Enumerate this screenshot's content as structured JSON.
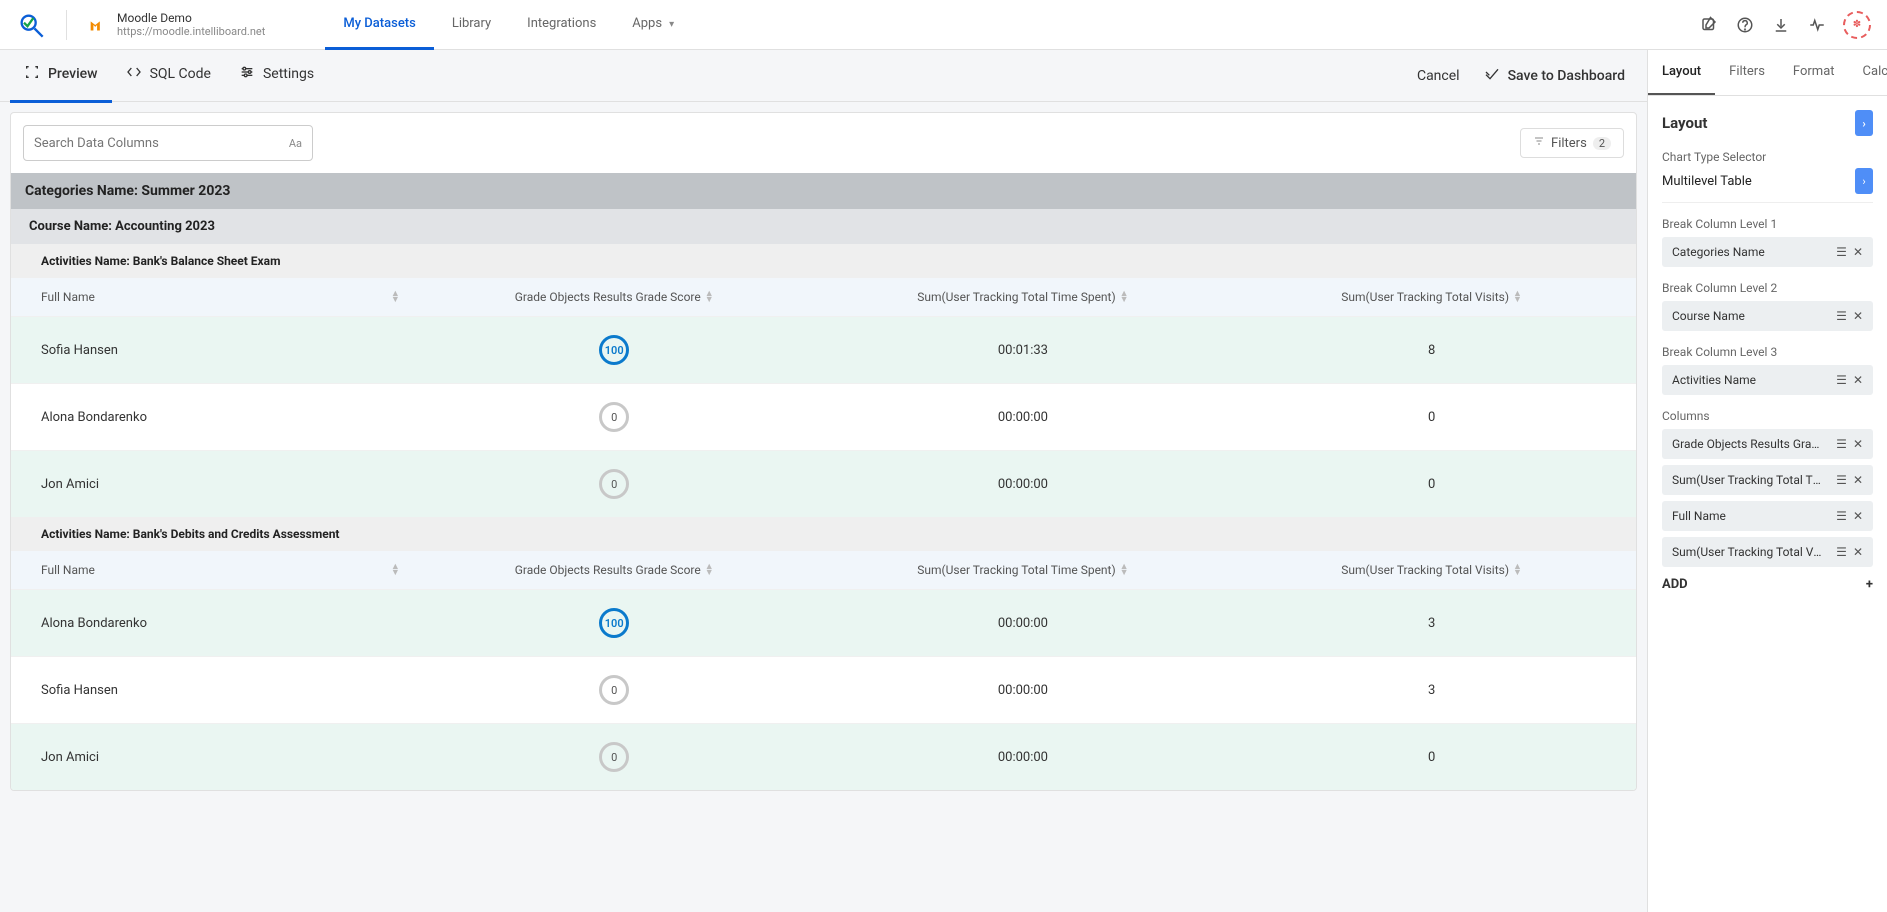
{
  "brand": {
    "title": "Moodle Demo",
    "url": "https://moodle.intelliboard.net"
  },
  "nav_tabs": [
    "My Datasets",
    "Library",
    "Integrations",
    "Apps"
  ],
  "nav_active": 0,
  "sub_tabs": {
    "preview": "Preview",
    "sql": "SQL Code",
    "settings": "Settings",
    "active": "preview"
  },
  "actions": {
    "cancel": "Cancel",
    "save": "Save to Dashboard"
  },
  "search": {
    "placeholder": "Search Data Columns",
    "aa": "Aa"
  },
  "filters_btn": {
    "label": "Filters",
    "count": "2"
  },
  "columns": [
    "Full Name",
    "Grade Objects Results Grade Score",
    "Sum(User Tracking Total Time Spent)",
    "Sum(User Tracking Total Visits)"
  ],
  "group_level1": {
    "prefix": "Categories Name:",
    "value": "Summer 2023"
  },
  "group_level2": {
    "prefix": "Course Name:",
    "value": "Accounting 2023"
  },
  "activities": [
    {
      "title_prefix": "Activities Name:",
      "title_value": "Bank's Balance Sheet Exam",
      "rows": [
        {
          "full_name": "Sofia Hansen",
          "grade": "100",
          "grade_full": true,
          "time": "00:01:33",
          "visits": "8"
        },
        {
          "full_name": "Alona Bondarenko",
          "grade": "0",
          "grade_full": false,
          "time": "00:00:00",
          "visits": "0"
        },
        {
          "full_name": "Jon Amici",
          "grade": "0",
          "grade_full": false,
          "time": "00:00:00",
          "visits": "0"
        }
      ]
    },
    {
      "title_prefix": "Activities Name:",
      "title_value": "Bank's Debits and Credits Assessment",
      "rows": [
        {
          "full_name": "Alona Bondarenko",
          "grade": "100",
          "grade_full": true,
          "time": "00:00:00",
          "visits": "3"
        },
        {
          "full_name": "Sofia Hansen",
          "grade": "0",
          "grade_full": false,
          "time": "00:00:00",
          "visits": "3"
        },
        {
          "full_name": "Jon Amici",
          "grade": "0",
          "grade_full": false,
          "time": "00:00:00",
          "visits": "0"
        }
      ]
    }
  ],
  "right_panel": {
    "tabs": [
      "Layout",
      "Filters",
      "Format",
      "Calc"
    ],
    "active": 0,
    "heading": "Layout",
    "chart_type_label": "Chart Type Selector",
    "chart_type_value": "Multilevel Table",
    "break_levels": [
      {
        "label": "Break Column Level 1",
        "value": "Categories Name"
      },
      {
        "label": "Break Column Level 2",
        "value": "Course Name"
      },
      {
        "label": "Break Column Level 3",
        "value": "Activities Name"
      }
    ],
    "columns_label": "Columns",
    "column_chips": [
      "Grade Objects Results Grade Sc...",
      "Sum(User Tracking Total Time S...",
      "Full Name",
      "Sum(User Tracking Total Visits)"
    ],
    "add_label": "ADD"
  }
}
